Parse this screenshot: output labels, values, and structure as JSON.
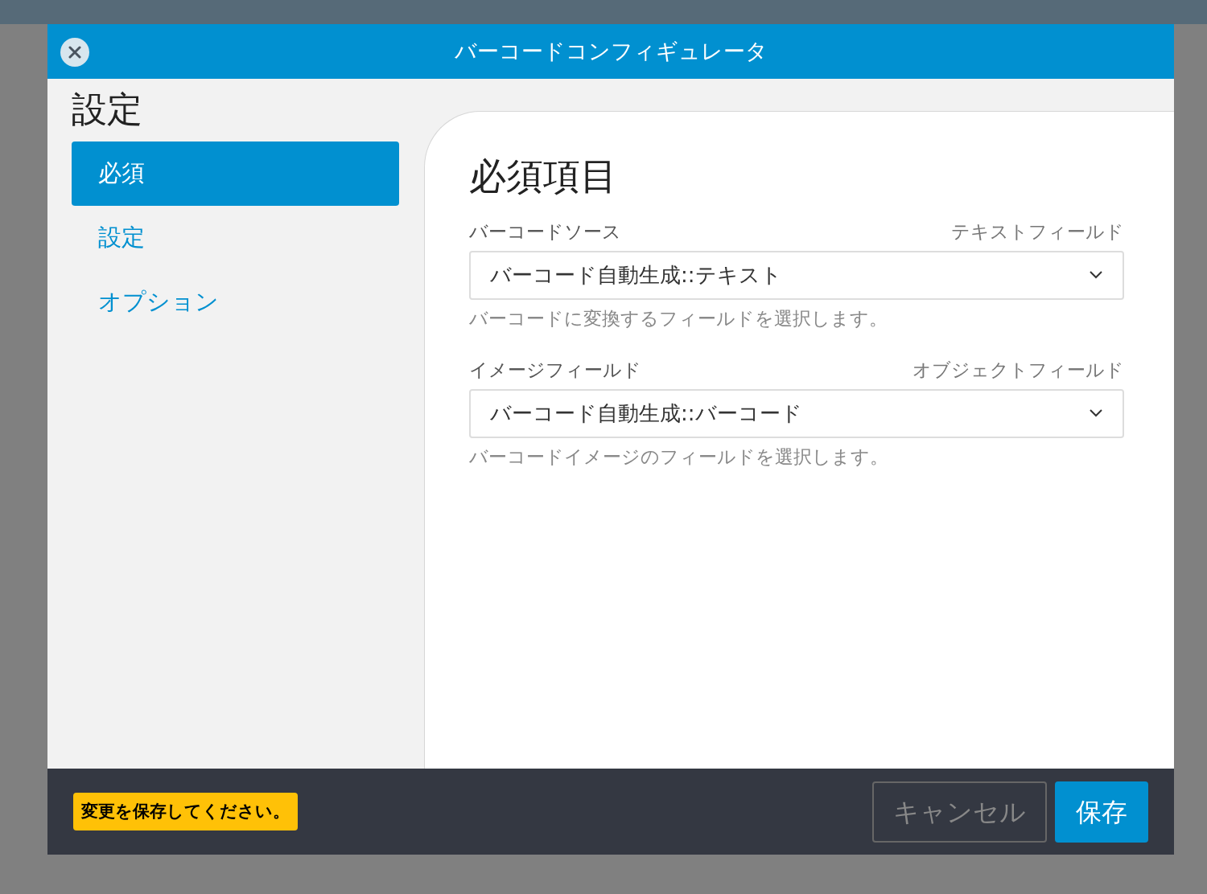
{
  "dialog": {
    "title": "バーコードコンフィギュレータ"
  },
  "sidebar": {
    "title": "設定",
    "items": [
      {
        "label": "必須",
        "selected": true
      },
      {
        "label": "設定",
        "selected": false
      },
      {
        "label": "オプション",
        "selected": false
      }
    ]
  },
  "panel": {
    "heading": "必須項目",
    "fields": [
      {
        "label": "バーコードソース",
        "type_hint": "テキストフィールド",
        "value": "バーコード自動生成::テキスト",
        "help": "バーコードに変換するフィールドを選択します。"
      },
      {
        "label": "イメージフィールド",
        "type_hint": "オブジェクトフィールド",
        "value": "バーコード自動生成::バーコード",
        "help": "バーコードイメージのフィールドを選択します。"
      }
    ]
  },
  "footer": {
    "notice": "変更を保存してください。",
    "buttons": [
      {
        "label": "キャンセル",
        "kind": "secondary"
      },
      {
        "label": "保存",
        "kind": "primary"
      }
    ]
  }
}
